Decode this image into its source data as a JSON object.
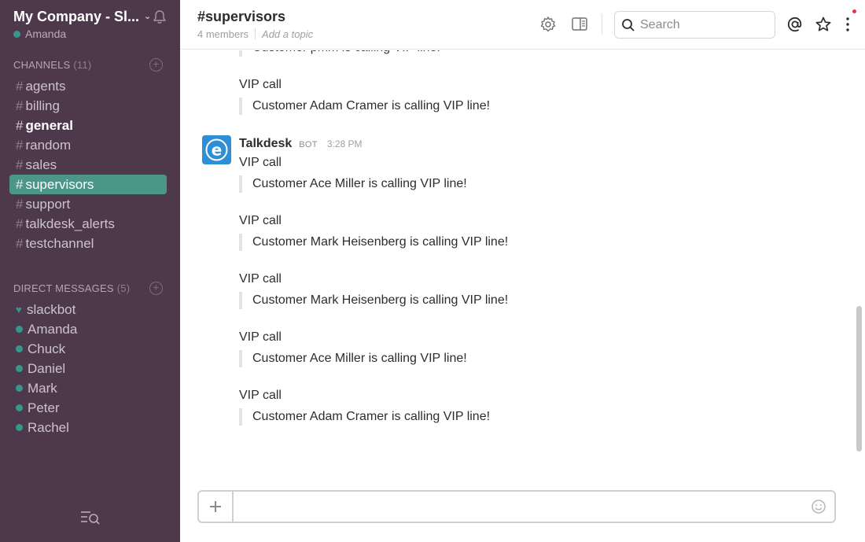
{
  "team": {
    "name": "My Company - Sl...",
    "user": "Amanda"
  },
  "channels_section": {
    "label": "CHANNELS",
    "count": "(11)"
  },
  "channels": [
    {
      "name": "agents",
      "bold": false,
      "active": false
    },
    {
      "name": "billing",
      "bold": false,
      "active": false
    },
    {
      "name": "general",
      "bold": true,
      "active": false
    },
    {
      "name": "random",
      "bold": false,
      "active": false
    },
    {
      "name": "sales",
      "bold": false,
      "active": false
    },
    {
      "name": "supervisors",
      "bold": false,
      "active": true
    },
    {
      "name": "support",
      "bold": false,
      "active": false
    },
    {
      "name": "talkdesk_alerts",
      "bold": false,
      "active": false
    },
    {
      "name": "testchannel",
      "bold": false,
      "active": false
    }
  ],
  "dm_section": {
    "label": "DIRECT MESSAGES",
    "count": "(5)"
  },
  "direct_messages": [
    {
      "name": "slackbot",
      "icon": "heart"
    },
    {
      "name": "Amanda",
      "icon": "dot"
    },
    {
      "name": "Chuck",
      "icon": "dot"
    },
    {
      "name": "Daniel",
      "icon": "dot"
    },
    {
      "name": "Mark",
      "icon": "dot"
    },
    {
      "name": "Peter",
      "icon": "dot"
    },
    {
      "name": "Rachel",
      "icon": "dot"
    }
  ],
  "header": {
    "title": "#supervisors",
    "members": "4 members",
    "topic": "Add a topic",
    "search_placeholder": "Search"
  },
  "messages": {
    "partial_top": "Customer pmm is calling VIP line!",
    "pre_bot": [
      {
        "label": "VIP call",
        "text": "Customer Adam Cramer is calling VIP line!"
      }
    ],
    "bot": {
      "name": "Talkdesk",
      "badge": "BOT",
      "time": "3:28 PM",
      "avatar_letter": "e"
    },
    "bot_items": [
      {
        "label": "VIP call",
        "text": "Customer Ace Miller is calling VIP line!"
      },
      {
        "label": "VIP call",
        "text": "Customer Mark Heisenberg is calling VIP line!"
      },
      {
        "label": "VIP call",
        "text": "Customer Mark Heisenberg is calling VIP line!"
      },
      {
        "label": "VIP call",
        "text": "Customer Ace Miller is calling VIP line!"
      },
      {
        "label": "VIP call",
        "text": "Customer Adam Cramer is calling VIP line!"
      }
    ]
  },
  "composer": {
    "placeholder": ""
  },
  "colors": {
    "sidebar": "#4d394b",
    "active_channel": "#4c9689",
    "presence": "#38978d",
    "bot_avatar": "#2d8fd8",
    "notification": "#e0354d"
  }
}
